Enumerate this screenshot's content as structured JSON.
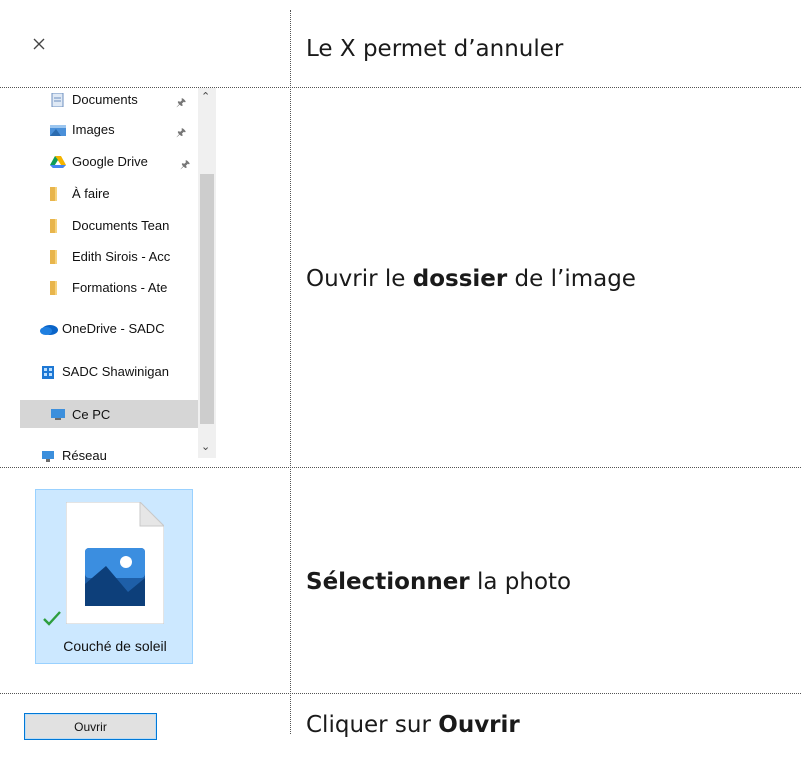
{
  "rows": [
    {
      "text": "Le X permet d’annuler"
    },
    {
      "pre": "Ouvrir le ",
      "bold": "dossier",
      "post": " de l’image"
    },
    {
      "bold": "Sélectionner",
      "post": " la photo"
    },
    {
      "pre": "Cliquer sur ",
      "bold": "Ouvrir"
    }
  ],
  "close_icon": "close-icon",
  "nav": {
    "items": [
      {
        "label": "Documents",
        "icon": "documents-icon",
        "pinned": true
      },
      {
        "label": "Images",
        "icon": "images-icon",
        "pinned": true
      },
      {
        "label": "Google Drive",
        "icon": "google-drive-icon",
        "pinned": true
      },
      {
        "label": "À faire",
        "icon": "folder-icon",
        "pinned": false
      },
      {
        "label": "Documents Tean",
        "icon": "folder-icon",
        "pinned": false
      },
      {
        "label": "Edith Sirois - Acc",
        "icon": "folder-icon",
        "pinned": false
      },
      {
        "label": "Formations - Ate",
        "icon": "folder-icon",
        "pinned": false
      },
      {
        "label": "OneDrive - SADC",
        "icon": "onedrive-icon",
        "pinned": false
      },
      {
        "label": "SADC Shawinigan",
        "icon": "building-icon",
        "pinned": false
      },
      {
        "label": "Ce PC",
        "icon": "computer-icon",
        "pinned": false,
        "selected": true
      },
      {
        "label": "Réseau",
        "icon": "network-icon",
        "pinned": false
      }
    ]
  },
  "file": {
    "name": "Couché de soleil",
    "icon": "image-file-icon"
  },
  "open_button": {
    "label": "Ouvrir"
  },
  "colors": {
    "selection": "#cce8ff",
    "accent": "#0078d7",
    "check": "#2e9e3e"
  }
}
